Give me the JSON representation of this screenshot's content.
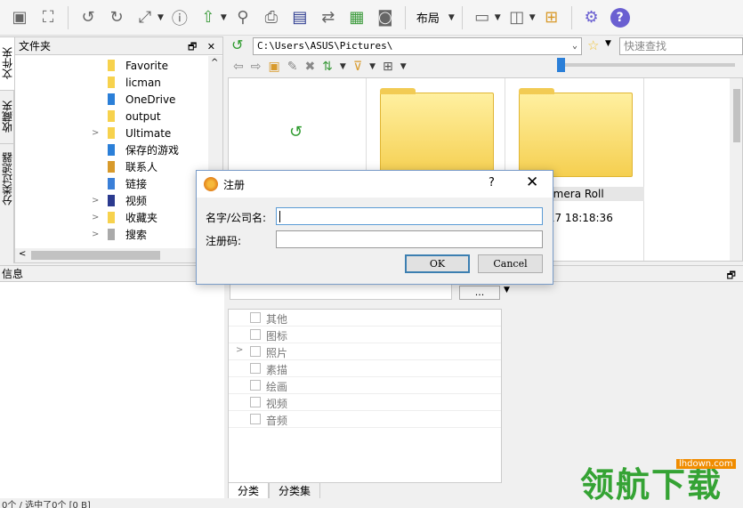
{
  "toolbar": {
    "layout_label": "布局"
  },
  "vertical_tabs": [
    "文件夹",
    "收藏夹",
    "分类过滤器"
  ],
  "folder_panel": {
    "title": "文件夹",
    "items": [
      {
        "label": "Favorite",
        "arrow": ""
      },
      {
        "label": "licman",
        "arrow": ""
      },
      {
        "label": "OneDrive",
        "arrow": ""
      },
      {
        "label": "output",
        "arrow": ""
      },
      {
        "label": "Ultimate",
        "arrow": ">"
      },
      {
        "label": "保存的游戏",
        "arrow": ""
      },
      {
        "label": "联系人",
        "arrow": ""
      },
      {
        "label": "链接",
        "arrow": ""
      },
      {
        "label": "视频",
        "arrow": ">"
      },
      {
        "label": "收藏夹",
        "arrow": ">"
      },
      {
        "label": "搜索",
        "arrow": ">"
      }
    ]
  },
  "address": {
    "path": "C:\\Users\\ASUS\\Pictures\\",
    "search_placeholder": "快速查找"
  },
  "files": [
    {
      "label": "amera Roll",
      "date": "3/17 18:18:36"
    }
  ],
  "info_panel": {
    "title": "信息"
  },
  "categories": {
    "items": [
      {
        "label": "其他",
        "arrow": ""
      },
      {
        "label": "图标",
        "arrow": ""
      },
      {
        "label": "照片",
        "arrow": ">"
      },
      {
        "label": "素描",
        "arrow": ""
      },
      {
        "label": "绘画",
        "arrow": ""
      },
      {
        "label": "视频",
        "arrow": ""
      },
      {
        "label": "音频",
        "arrow": ""
      }
    ],
    "more_label": "...",
    "tabs": [
      "分类",
      "分类集"
    ]
  },
  "status": {
    "text": "0个 / 选中了0个 [0 B]"
  },
  "dialog": {
    "title": "注册",
    "help": "?",
    "close": "✕",
    "name_label": "名字/公司名:",
    "code_label": "注册码:",
    "ok_label": "OK",
    "cancel_label": "Cancel"
  },
  "watermark": {
    "text": "领航下载",
    "url": "lhdown.com"
  }
}
